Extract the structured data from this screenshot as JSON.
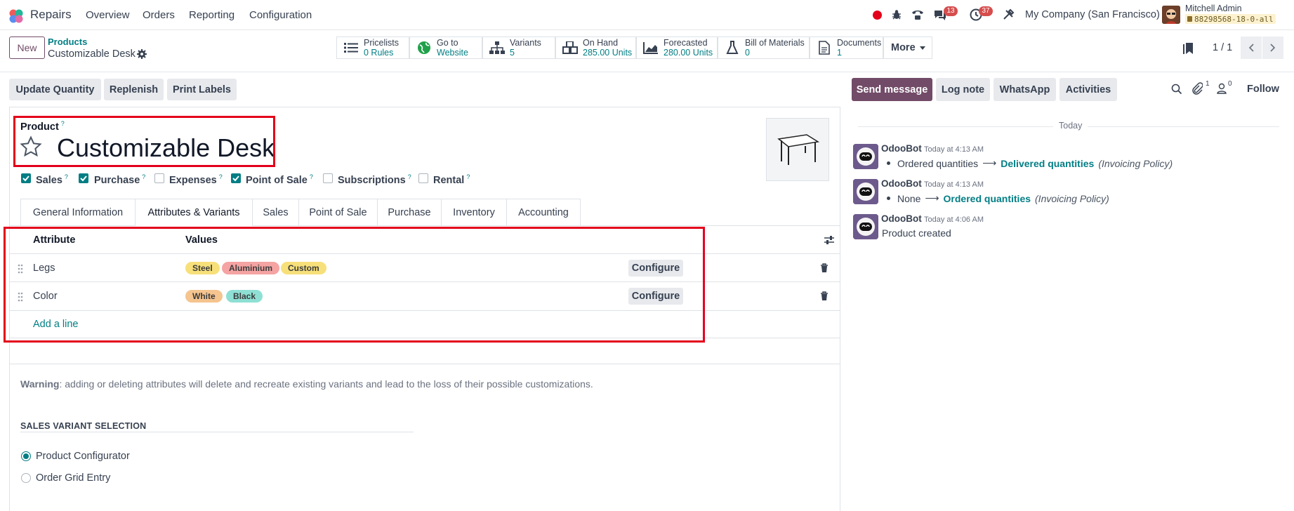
{
  "app": {
    "name": "Repairs"
  },
  "nav": {
    "menus": [
      "Overview",
      "Orders",
      "Reporting",
      "Configuration"
    ]
  },
  "systray": {
    "messages_count": "13",
    "activities_count": "37",
    "company": "My Company (San Francisco)",
    "user_name": "Mitchell Admin",
    "database": "88298568-18-0-all"
  },
  "breadcrumb": {
    "parent": "Products",
    "current": "Customizable Desk"
  },
  "buttons": {
    "new": "New"
  },
  "smart_buttons": [
    {
      "title": "Pricelists",
      "value": "0 Rules"
    },
    {
      "title": "Go to",
      "value": "Website"
    },
    {
      "title": "Variants",
      "value": "5"
    },
    {
      "title": "On Hand",
      "value": "285.00 Units"
    },
    {
      "title": "Forecasted",
      "value": "280.00 Units"
    },
    {
      "title": "Bill of Materials",
      "value": "0"
    },
    {
      "title": "Documents",
      "value": "1"
    }
  ],
  "more_label": "More",
  "pager": {
    "text": "1 / 1"
  },
  "actions": [
    "Update Quantity",
    "Replenish",
    "Print Labels"
  ],
  "form": {
    "product_label": "Product",
    "help_mark": "?",
    "product_name": "Customizable Desk",
    "checkboxes": [
      {
        "label": "Sales",
        "checked": true
      },
      {
        "label": "Purchase",
        "checked": true
      },
      {
        "label": "Expenses",
        "checked": false
      },
      {
        "label": "Point of Sale",
        "checked": true
      },
      {
        "label": "Subscriptions",
        "checked": false
      },
      {
        "label": "Rental",
        "checked": false
      }
    ],
    "tabs": [
      "General Information",
      "Attributes & Variants",
      "Sales",
      "Point of Sale",
      "Purchase",
      "Inventory",
      "Accounting"
    ],
    "active_tab": "Attributes & Variants",
    "table": {
      "headers": [
        "Attribute",
        "Values"
      ],
      "rows": [
        {
          "attribute": "Legs",
          "values": [
            {
              "label": "Steel",
              "color": "#f7e07a"
            },
            {
              "label": "Aluminium",
              "color": "#f5a3a3"
            },
            {
              "label": "Custom",
              "color": "#f7e07a"
            }
          ],
          "configure": "Configure"
        },
        {
          "attribute": "Color",
          "values": [
            {
              "label": "White",
              "color": "#f5c48f"
            },
            {
              "label": "Black",
              "color": "#8fe0d4"
            }
          ],
          "configure": "Configure"
        }
      ],
      "add_line": "Add a line"
    },
    "warning_label": "Warning",
    "warning_text": ": adding or deleting attributes will delete and recreate existing variants and lead to the loss of their possible customizations.",
    "section_title": "SALES VARIANT SELECTION",
    "radio_options": [
      {
        "label": "Product Configurator",
        "selected": true
      },
      {
        "label": "Order Grid Entry",
        "selected": false
      }
    ]
  },
  "chatter": {
    "buttons": [
      "Send message",
      "Log note",
      "WhatsApp",
      "Activities"
    ],
    "attachments_count": "1",
    "followers_count": "0",
    "follow_label": "Follow",
    "date_separator": "Today",
    "messages": [
      {
        "author": "OdooBot",
        "time": "Today at 4:13 AM",
        "old": "Ordered quantities",
        "new": "Delivered quantities",
        "field": "(Invoicing Policy)"
      },
      {
        "author": "OdooBot",
        "time": "Today at 4:13 AM",
        "old": "None",
        "new": "Ordered quantities",
        "field": "(Invoicing Policy)"
      },
      {
        "author": "OdooBot",
        "time": "Today at 4:06 AM",
        "body": "Product created"
      }
    ]
  },
  "colors": {
    "brand": "#714b67",
    "teal": "#017e84",
    "highlight": "#e3001b"
  }
}
